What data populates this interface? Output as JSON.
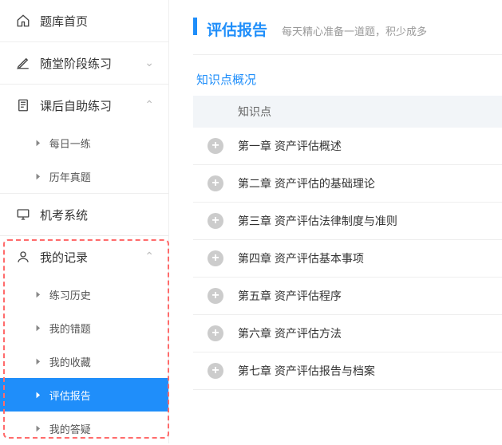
{
  "sidebar": {
    "home": {
      "label": "题库首页"
    },
    "in_class": {
      "label": "随堂阶段练习"
    },
    "after": {
      "label": "课后自助练习",
      "sub": [
        {
          "label": "每日一练"
        },
        {
          "label": "历年真题"
        }
      ]
    },
    "exam": {
      "label": "机考系统"
    },
    "record": {
      "label": "我的记录",
      "sub": [
        {
          "label": "练习历史"
        },
        {
          "label": "我的错题"
        },
        {
          "label": "我的收藏"
        },
        {
          "label": "评估报告",
          "selected": true
        },
        {
          "label": "我的答疑"
        }
      ]
    }
  },
  "header": {
    "title": "评估报告",
    "subtitle": "每天精心准备一道题，积少成多"
  },
  "section": {
    "title": "知识点概况",
    "col": "知识点"
  },
  "rows": [
    {
      "text": "第一章 资产评估概述"
    },
    {
      "text": "第二章 资产评估的基础理论"
    },
    {
      "text": "第三章 资产评估法律制度与准则"
    },
    {
      "text": "第四章 资产评估基本事项"
    },
    {
      "text": "第五章 资产评估程序"
    },
    {
      "text": "第六章 资产评估方法"
    },
    {
      "text": "第七章 资产评估报告与档案"
    }
  ]
}
